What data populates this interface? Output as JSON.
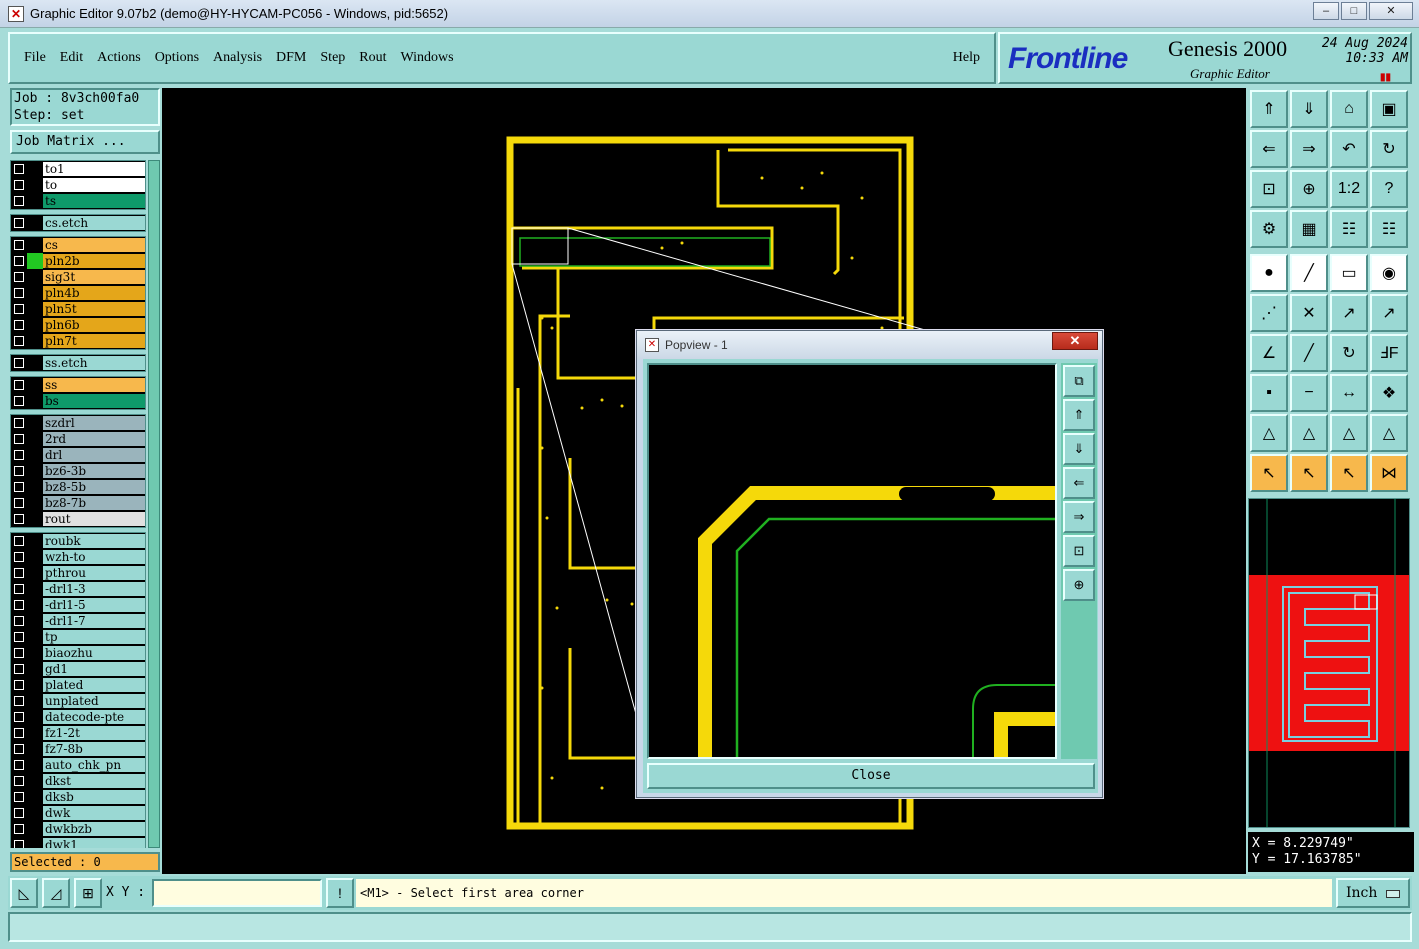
{
  "window": {
    "title": "Graphic Editor 9.07b2 (demo@HY-HYCAM-PC056 - Windows, pid:5652)"
  },
  "menu": [
    {
      "label": "File"
    },
    {
      "label": "Edit"
    },
    {
      "label": "Actions"
    },
    {
      "label": "Options"
    },
    {
      "label": "Analysis"
    },
    {
      "label": "DFM"
    },
    {
      "label": "Step"
    },
    {
      "label": "Rout"
    },
    {
      "label": "Windows"
    }
  ],
  "help_label": "Help",
  "brand": {
    "logo": "Frontline",
    "product": "Genesis 2000",
    "subtitle": "Graphic Editor",
    "date": "24 Aug 2024",
    "time": "10:33 AM"
  },
  "job": {
    "job_line": "Job : 8v3ch00fa0",
    "step_line": "Step: set",
    "matrix_btn": "Job Matrix ..."
  },
  "layer_groups": [
    [
      {
        "name": "to1",
        "color": "#ffffff"
      },
      {
        "name": "to",
        "color": "#ffffff"
      },
      {
        "name": "ts",
        "color": "#0e9a6a"
      }
    ],
    [
      {
        "name": "cs.etch",
        "color": "#9ad8d3"
      }
    ],
    [
      {
        "name": "cs",
        "color": "#f7b84c"
      },
      {
        "name": "pln2b",
        "color": "#e4a61a",
        "active": true
      },
      {
        "name": "sig3t",
        "color": "#f7b84c"
      },
      {
        "name": "pln4b",
        "color": "#e4a61a"
      },
      {
        "name": "pln5t",
        "color": "#e4a61a"
      },
      {
        "name": "pln6b",
        "color": "#e4a61a"
      },
      {
        "name": "pln7t",
        "color": "#e4a61a"
      }
    ],
    [
      {
        "name": "ss.etch",
        "color": "#9ad8d3"
      }
    ],
    [
      {
        "name": "ss",
        "color": "#f7b84c"
      },
      {
        "name": "bs",
        "color": "#0e9a6a"
      }
    ],
    [
      {
        "name": "szdrl",
        "color": "#9ab4bc"
      },
      {
        "name": "2rd",
        "color": "#9ab4bc"
      },
      {
        "name": "drl",
        "color": "#9ab4bc"
      },
      {
        "name": "bz6-3b",
        "color": "#9ab4bc"
      },
      {
        "name": "bz8-5b",
        "color": "#9ab4bc"
      },
      {
        "name": "bz8-7b",
        "color": "#9ab4bc"
      },
      {
        "name": "rout",
        "color": "#e0e0e0"
      }
    ],
    [
      {
        "name": "roubk",
        "color": "#9ad8d3"
      },
      {
        "name": "wzh-to",
        "color": "#9ad8d3"
      },
      {
        "name": "pthrou",
        "color": "#9ad8d3"
      },
      {
        "name": "-drl1-3",
        "color": "#9ad8d3"
      },
      {
        "name": "-drl1-5",
        "color": "#9ad8d3"
      },
      {
        "name": "-drl1-7",
        "color": "#9ad8d3"
      },
      {
        "name": "tp",
        "color": "#9ad8d3"
      },
      {
        "name": "biaozhu",
        "color": "#9ad8d3"
      },
      {
        "name": "gd1",
        "color": "#9ad8d3"
      },
      {
        "name": "plated",
        "color": "#9ad8d3"
      },
      {
        "name": "unplated",
        "color": "#9ad8d3"
      },
      {
        "name": "datecode-pte",
        "color": "#9ad8d3"
      },
      {
        "name": "fz1-2t",
        "color": "#9ad8d3"
      },
      {
        "name": "fz7-8b",
        "color": "#9ad8d3"
      },
      {
        "name": "auto_chk_pn",
        "color": "#9ad8d3"
      },
      {
        "name": "dkst",
        "color": "#9ad8d3"
      },
      {
        "name": "dksb",
        "color": "#9ad8d3"
      },
      {
        "name": "dwk",
        "color": "#9ad8d3"
      },
      {
        "name": "dwkbzb",
        "color": "#9ad8d3"
      },
      {
        "name": "dwk1",
        "color": "#9ad8d3"
      }
    ]
  ],
  "selected": "Selected : 0",
  "coords": {
    "x": "X = 8.229749\"",
    "y": "Y = 17.163785\""
  },
  "status": {
    "xy_label": "X Y :",
    "xy_value": "",
    "prompt": "<M1> - Select first area corner",
    "unit": "Inch"
  },
  "popup": {
    "title": "Popview - 1",
    "close_label": "Close"
  },
  "colors": {
    "panel": "#9ad8d3",
    "layer_active": "#e4a61a",
    "copper": "#f5d90a",
    "outline": "#20b020",
    "minimap_fill": "#ee1111"
  }
}
